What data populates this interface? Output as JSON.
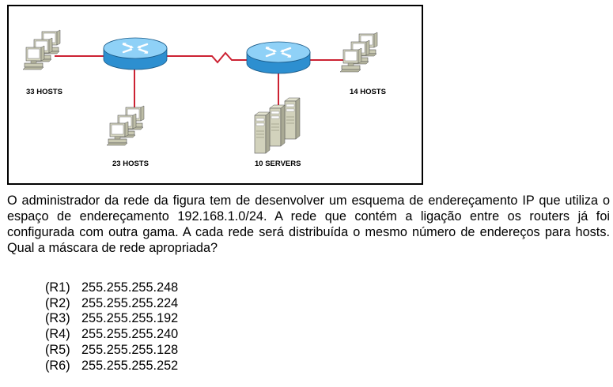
{
  "diagram": {
    "nodes": [
      {
        "id": "lan-a",
        "type": "workstation-group",
        "label": "33 HOSTS"
      },
      {
        "id": "lan-b",
        "type": "workstation-group",
        "label": "23 HOSTS"
      },
      {
        "id": "lan-c",
        "type": "server-group",
        "label": "10 SERVERS"
      },
      {
        "id": "lan-d",
        "type": "workstation-group",
        "label": "14 HOSTS"
      },
      {
        "id": "router-1",
        "type": "router",
        "label": ""
      },
      {
        "id": "router-2",
        "type": "router",
        "label": ""
      }
    ],
    "links": [
      {
        "from": "lan-a",
        "to": "router-1",
        "kind": "ethernet"
      },
      {
        "from": "router-1",
        "to": "lan-b",
        "kind": "ethernet"
      },
      {
        "from": "router-1",
        "to": "router-2",
        "kind": "serial"
      },
      {
        "from": "router-2",
        "to": "lan-c",
        "kind": "ethernet"
      },
      {
        "from": "router-2",
        "to": "lan-d",
        "kind": "ethernet"
      }
    ],
    "colors": {
      "link": "#cc2233",
      "router_body": "#2d8fd0",
      "router_top": "#8fd1f7",
      "device_body": "#d2d2bc",
      "device_screen": "#ffffff"
    }
  },
  "question": {
    "text": "O administrador da rede da figura tem de desenvolver um esquema de endereçamento IP que utiliza o espaço de endereçamento 192.168.1.0/24. A rede que contém a ligação entre os routers já foi configurada com outra gama. A cada rede será distribuída o mesmo número de endereços para hosts. Qual a máscara de rede apropriada?"
  },
  "options": [
    {
      "code": "(R1)",
      "value": "255.255.255.248"
    },
    {
      "code": "(R2)",
      "value": "255.255.255.224"
    },
    {
      "code": "(R3)",
      "value": "255.255.255.192"
    },
    {
      "code": "(R4)",
      "value": "255.255.255.240"
    },
    {
      "code": "(R5)",
      "value": "255.255.255.128"
    },
    {
      "code": "(R6)",
      "value": "255.255.255.252"
    }
  ]
}
